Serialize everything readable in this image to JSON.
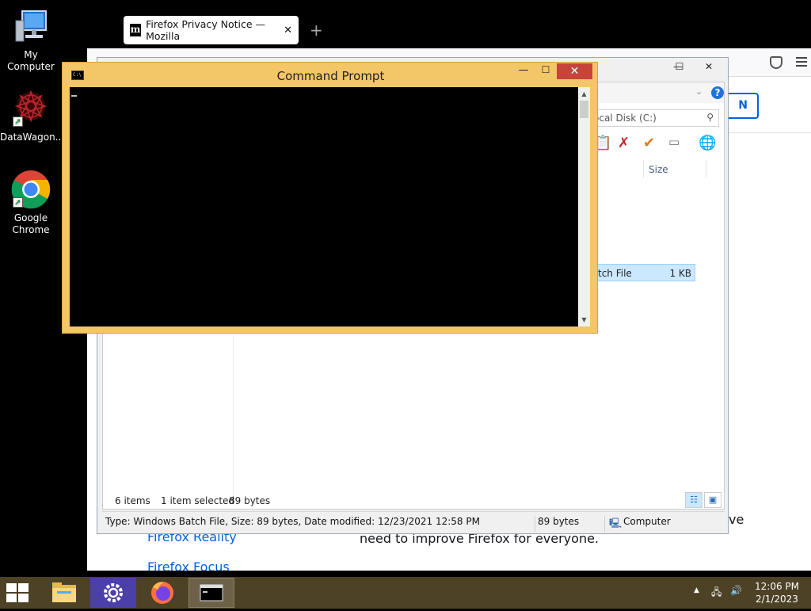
{
  "desktop": {
    "icons": [
      {
        "label": "My Computer"
      },
      {
        "label": "DataWagon..."
      },
      {
        "label": "Google Chrome"
      }
    ]
  },
  "firefox": {
    "tab_title": "Firefox Privacy Notice — Mozilla",
    "favicon_letter": "m",
    "new_tab": "+",
    "signin_label": "N",
    "link_1": "Firefox Reality",
    "link_2": "Firefox Focus",
    "body_text": "need to improve Firefox for everyone.",
    "body_text_partial": "ve"
  },
  "explorer": {
    "search_placeholder": "ocal Disk (C:)",
    "column_size": "Size",
    "selected_row_type": "tch File",
    "selected_row_size": "1 KB",
    "status_items": "6 items",
    "status_selected": "1 item selected",
    "status_selected_size": "89 bytes",
    "info_text": "Type: Windows Batch File, Size: 89 bytes, Date modified: 12/23/2021 12:58 PM",
    "info_size": "89 bytes",
    "info_location": "Computer"
  },
  "cmd": {
    "title": "Command Prompt",
    "icon_text": "C:\\",
    "min": "—",
    "max": "☐",
    "close": "✕"
  },
  "taskbar": {
    "time": "12:06 PM",
    "date": "2/1/2023",
    "apps": [
      {
        "name": "File Explorer"
      },
      {
        "name": "Settings"
      },
      {
        "name": "Firefox"
      },
      {
        "name": "Command Prompt"
      }
    ]
  },
  "colors": {
    "cmd_frame": "#f3c668",
    "cmd_close": "#c7443a",
    "taskbar": "#4d4226",
    "firefox_link": "#0061e0"
  }
}
